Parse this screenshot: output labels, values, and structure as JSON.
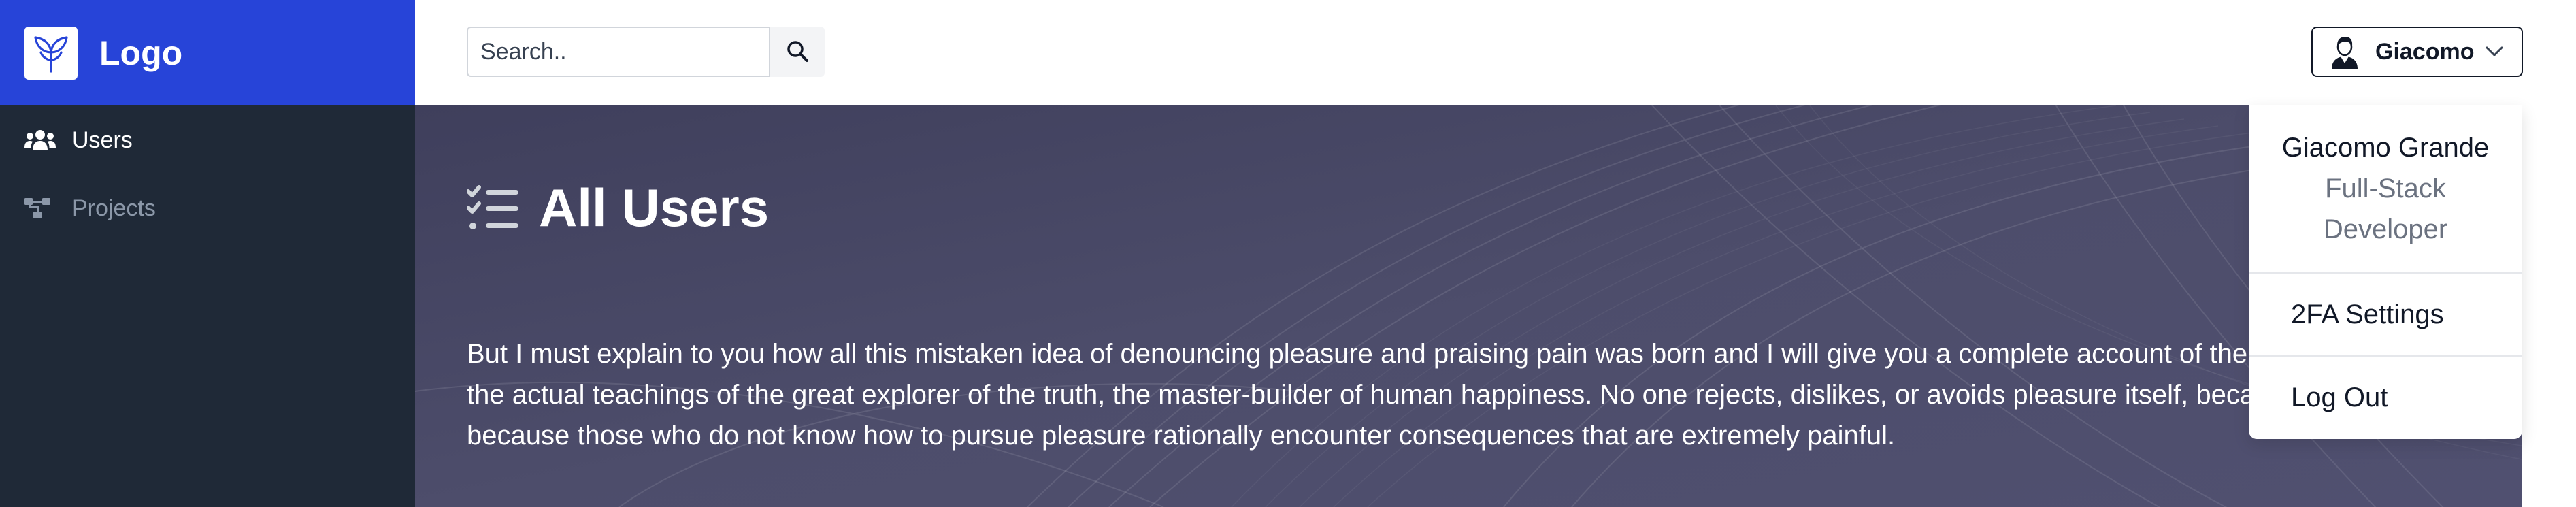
{
  "brand": {
    "logo_text": "Logo",
    "color": "#2744d8"
  },
  "sidebar": {
    "items": [
      {
        "label": "Users",
        "icon": "users-icon",
        "active": true
      },
      {
        "label": "Projects",
        "icon": "projects-icon",
        "active": false
      }
    ]
  },
  "header": {
    "search": {
      "placeholder": "Search.."
    },
    "user": {
      "name": "Giacomo"
    }
  },
  "dropdown": {
    "full_name": "Giacomo Grande",
    "role": "Full-Stack Developer",
    "items": [
      "2FA Settings",
      "Log Out"
    ]
  },
  "main": {
    "title": "All Users",
    "paragraph_lines": [
      "But I must explain to you how all this mistaken idea of denouncing pleasure and praising pain was born and I will give you a complete account of the",
      "the actual teachings of the great explorer of the truth, the master-builder of human happiness. No one rejects, dislikes, or avoids pleasure itself, beca",
      "because those who do not know how to pursue pleasure rationally encounter consequences that are extremely painful."
    ]
  }
}
